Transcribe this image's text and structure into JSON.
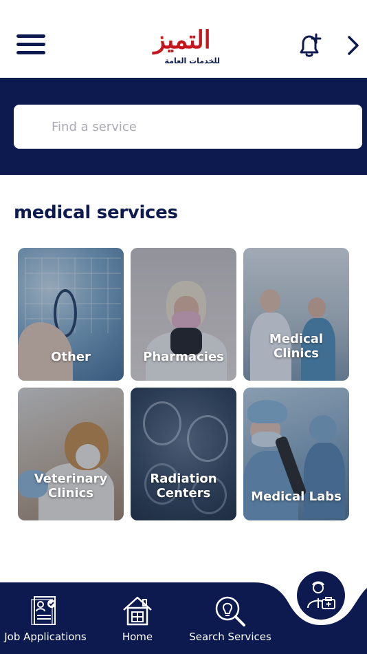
{
  "header": {
    "logo": {
      "name": "التميز",
      "tagline": "للخدمات العامة"
    }
  },
  "search": {
    "placeholder": "Find a service"
  },
  "section": {
    "title": "medical services"
  },
  "services": [
    {
      "label": "Other",
      "image": "stethoscope-digital-icons"
    },
    {
      "label": "Pharmacies",
      "image": "pharmacist-in-hijab"
    },
    {
      "label": "Medical\nClinics",
      "image": "doctors-in-clinic"
    },
    {
      "label": "Veterinary\nClinics",
      "image": "puppy-held-by-vet"
    },
    {
      "label": "Radiation\nCenters",
      "image": "brain-scans"
    },
    {
      "label": "Medical Labs",
      "image": "lab-scientists-microscope"
    }
  ],
  "bottom_nav": {
    "items": [
      {
        "label": "Job Applications",
        "icon": "resume-checklist-icon"
      },
      {
        "label": "Home",
        "icon": "house-icon"
      },
      {
        "label": "Search Services",
        "icon": "lightbulb-search-icon"
      }
    ],
    "fab_icon": "doctor-briefcase-icon"
  },
  "colors": {
    "navy": "#0c1a4f",
    "brand_red": "#c4161c",
    "white": "#ffffff"
  }
}
